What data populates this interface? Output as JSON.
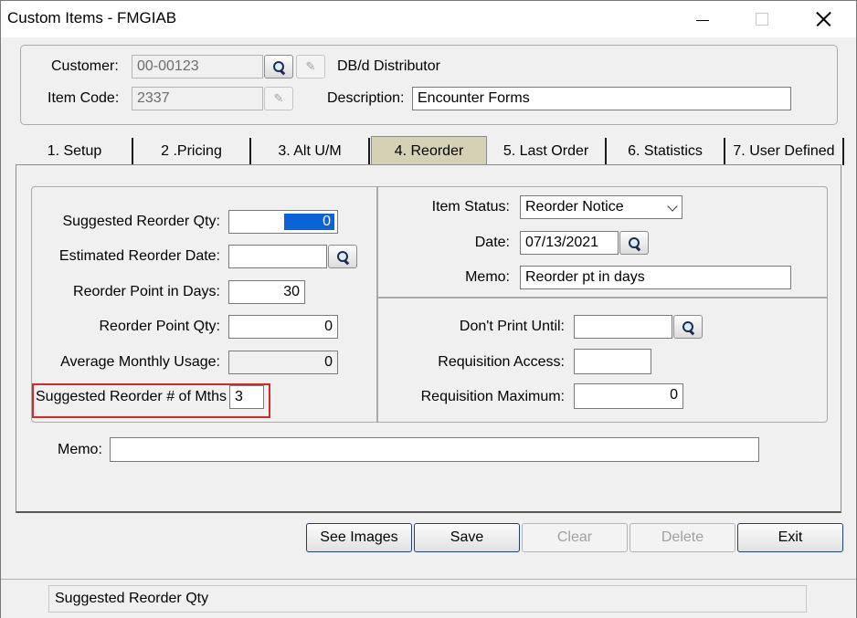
{
  "window": {
    "title": "Custom Items - FMGIAB"
  },
  "header": {
    "customer_label": "Customer:",
    "customer_value": "00-00123",
    "customer_name": "DB/d Distributor",
    "item_code_label": "Item Code:",
    "item_code_value": "2337",
    "description_label": "Description:",
    "description_value": "Encounter Forms"
  },
  "tabs": [
    {
      "label": "1. Setup",
      "active": false
    },
    {
      "label": "2 .Pricing",
      "active": false
    },
    {
      "label": "3. Alt U/M",
      "active": false
    },
    {
      "label": "4. Reorder",
      "active": true
    },
    {
      "label": "5. Last Order",
      "active": false
    },
    {
      "label": "6. Statistics",
      "active": false
    },
    {
      "label": "7. User Defined",
      "active": false
    }
  ],
  "reorder": {
    "suggested_qty_label": "Suggested Reorder Qty:",
    "suggested_qty_value": "0",
    "est_date_label": "Estimated Reorder Date:",
    "est_date_value": "",
    "point_days_label": "Reorder Point in Days:",
    "point_days_value": "30",
    "point_qty_label": "Reorder Point Qty:",
    "point_qty_value": "0",
    "avg_usage_label": "Average Monthly Usage:",
    "avg_usage_value": "0",
    "mths_label": "Suggested Reorder # of Mths",
    "mths_value": "3",
    "item_status_label": "Item Status:",
    "item_status_value": "Reorder Notice",
    "date_label": "Date:",
    "date_value": "07/13/2021",
    "memo_label": "Memo:",
    "memo_value": "Reorder pt in days",
    "dont_print_label": "Don't Print Until:",
    "dont_print_value": "",
    "req_access_label": "Requisition Access:",
    "req_access_value": "",
    "req_max_label": "Requisition Maximum:",
    "req_max_value": "0"
  },
  "memo": {
    "label": "Memo:",
    "value": ""
  },
  "buttons": {
    "see_images": "See Images",
    "save": "Save",
    "clear": "Clear",
    "delete": "Delete",
    "exit": "Exit"
  },
  "status": {
    "text": "Suggested Reorder Qty"
  },
  "colors": {
    "active_tab": "#d4d1b5",
    "highlight_box": "#d62828",
    "selection": "#0a64d8"
  }
}
